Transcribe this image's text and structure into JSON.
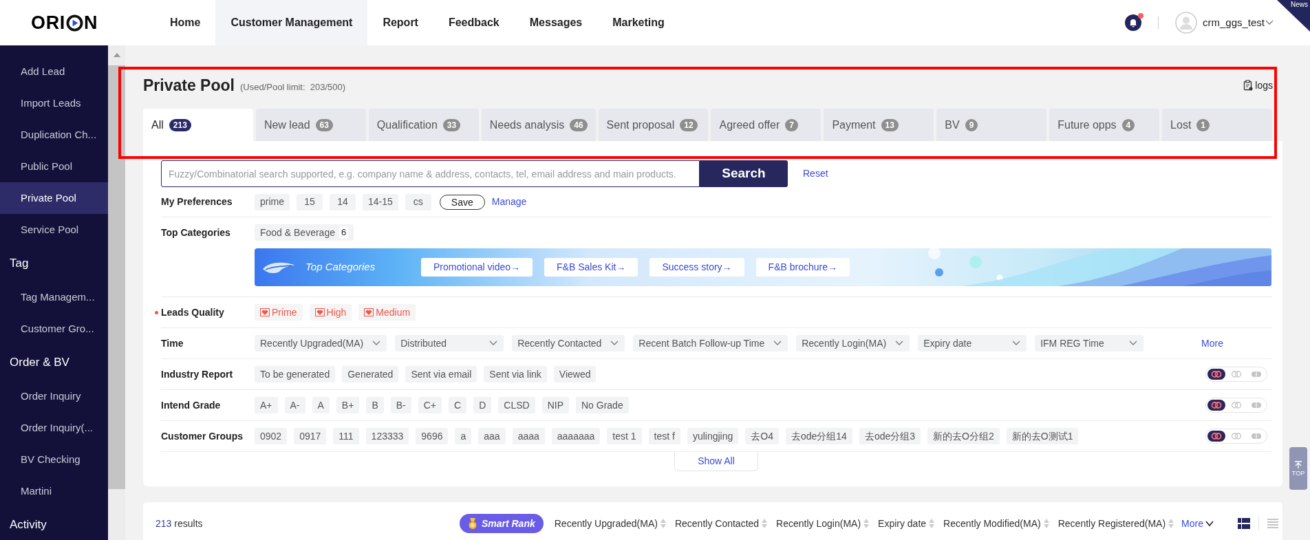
{
  "logo": {
    "before": "ORI",
    "after": "N"
  },
  "nav": [
    {
      "label": "Home",
      "selected": false
    },
    {
      "label": "Customer Management",
      "selected": true
    },
    {
      "label": "Report",
      "selected": false
    },
    {
      "label": "Feedback",
      "selected": false
    },
    {
      "label": "Messages",
      "selected": false
    },
    {
      "label": "Marketing",
      "selected": false
    }
  ],
  "notifications": {
    "unread": true
  },
  "user": {
    "name": "crm_ggs_test"
  },
  "news_ribbon": "News",
  "sidebar": [
    {
      "kind": "item",
      "label": "Add Lead",
      "selected": false
    },
    {
      "kind": "item",
      "label": "Import Leads",
      "selected": false
    },
    {
      "kind": "item",
      "label": "Duplication Ch...",
      "selected": false
    },
    {
      "kind": "item",
      "label": "Public Pool",
      "selected": false
    },
    {
      "kind": "item",
      "label": "Private Pool",
      "selected": true
    },
    {
      "kind": "item",
      "label": "Service Pool",
      "selected": false
    },
    {
      "kind": "section",
      "label": "Tag"
    },
    {
      "kind": "item",
      "label": "Tag Managem...",
      "selected": false
    },
    {
      "kind": "item",
      "label": "Customer Gro...",
      "selected": false
    },
    {
      "kind": "section",
      "label": "Order & BV"
    },
    {
      "kind": "item",
      "label": "Order Inquiry",
      "selected": false
    },
    {
      "kind": "item",
      "label": "Order Inquiry(...",
      "selected": false
    },
    {
      "kind": "item",
      "label": "BV Checking",
      "selected": false
    },
    {
      "kind": "item",
      "label": "Martini",
      "selected": false
    },
    {
      "kind": "section",
      "label": "Activity"
    }
  ],
  "page": {
    "title": "Private Pool",
    "limit": "(Used/Pool limit:  203/500)",
    "logs": "logs"
  },
  "tabs": [
    {
      "label": "All",
      "count": "213",
      "selected": true
    },
    {
      "label": "New lead",
      "count": "63",
      "selected": false
    },
    {
      "label": "Qualification",
      "count": "33",
      "selected": false
    },
    {
      "label": "Needs analysis",
      "count": "46",
      "selected": false
    },
    {
      "label": "Sent proposal",
      "count": "12",
      "selected": false
    },
    {
      "label": "Agreed offer",
      "count": "7",
      "selected": false
    },
    {
      "label": "Payment",
      "count": "13",
      "selected": false
    },
    {
      "label": "BV",
      "count": "9",
      "selected": false
    },
    {
      "label": "Future opps",
      "count": "4",
      "selected": false
    },
    {
      "label": "Lost",
      "count": "1",
      "selected": false
    }
  ],
  "search": {
    "placeholder": "Fuzzy/Combinatorial search supported, e.g. company name & address, contacts, tel, email address and main products.",
    "button": "Search",
    "reset": "Reset"
  },
  "preferences": {
    "label": "My Preferences",
    "chips": [
      "prime",
      "15",
      "14",
      "14-15",
      "cs"
    ],
    "save": "Save",
    "manage": "Manage"
  },
  "top_categories": {
    "label": "Top Categories",
    "chips": [
      {
        "label": "Food & Beverage",
        "count": "6"
      }
    ],
    "banner": {
      "title": "Top Categories",
      "links": [
        "Promotional video→",
        "F&B Sales Kit→",
        "Success story→",
        "F&B brochure→"
      ]
    }
  },
  "filter_rows": [
    {
      "kind": "quality",
      "label": "Leads Quality",
      "required": true,
      "options": [
        "Prime",
        "High",
        "Medium"
      ]
    },
    {
      "kind": "dropdowns",
      "label": "Time",
      "required": false,
      "options": [
        "Recently Upgraded(MA)",
        "Distributed",
        "Recently Contacted",
        "Recent Batch Follow-up Time",
        "Recently Login(MA)",
        "Expiry date",
        "IFM REG Time"
      ],
      "more": "More"
    },
    {
      "kind": "chips",
      "label": "Industry Report",
      "required": false,
      "options": [
        "To be generated",
        "Generated",
        "Sent via email",
        "Sent via link",
        "Viewed"
      ],
      "modes": [
        {
          "kind": "union",
          "selected": true
        },
        {
          "kind": "intersection",
          "selected": false
        },
        {
          "kind": "exclude",
          "selected": false
        }
      ]
    },
    {
      "kind": "chips",
      "label": "Intend Grade",
      "required": false,
      "options": [
        "A+",
        "A-",
        "A",
        "B+",
        "B",
        "B-",
        "C+",
        "C",
        "D",
        "CLSD",
        "NIP",
        "No Grade"
      ],
      "modes": [
        {
          "kind": "union",
          "selected": true
        },
        {
          "kind": "intersection",
          "selected": false
        },
        {
          "kind": "exclude",
          "selected": false
        }
      ]
    },
    {
      "kind": "chips",
      "label": "Customer Groups",
      "required": false,
      "options": [
        "0902",
        "0917",
        "111",
        "123333",
        "9696",
        "a",
        "aaa",
        "aaaa",
        "aaaaaaa",
        "test 1",
        "test f",
        "yulingjing",
        "去O4",
        "去ode分组14",
        "去ode分组3",
        "新的去O分组2",
        "新的去O测试1"
      ],
      "modes": [
        {
          "kind": "union",
          "selected": true
        },
        {
          "kind": "intersection",
          "selected": false
        },
        {
          "kind": "exclude",
          "selected": false
        }
      ]
    }
  ],
  "show_all": "Show All",
  "results": {
    "count": "213",
    "label": "results",
    "smart_rank": "Smart Rank",
    "sorts": [
      "Recently Upgraded(MA)",
      "Recently Contacted",
      "Recently Login(MA)",
      "Expiry date",
      "Recently Modified(MA)",
      "Recently Registered(MA)"
    ],
    "more": "More",
    "views": [
      {
        "kind": "grid",
        "selected": true
      },
      {
        "kind": "list",
        "selected": false
      }
    ]
  },
  "back_to_top": "TOP"
}
